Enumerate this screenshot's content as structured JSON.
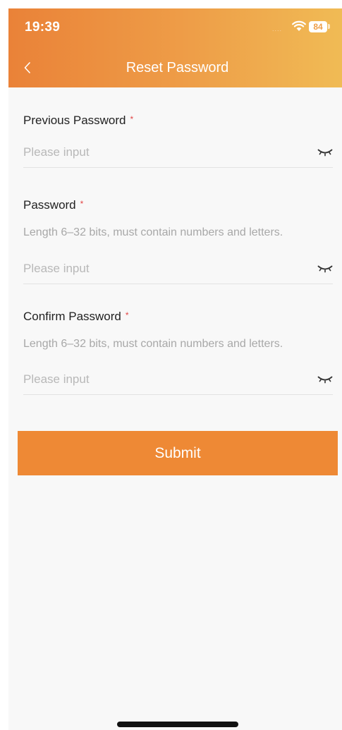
{
  "status_bar": {
    "time": "19:39",
    "signal": "....",
    "battery": "84"
  },
  "nav": {
    "title": "Reset Password",
    "back_icon": "chevron-left-icon"
  },
  "form": {
    "required_mark": "*",
    "fields": [
      {
        "label": "Previous Password",
        "hint": "",
        "placeholder": "Please input",
        "icon": "eye-closed-icon"
      },
      {
        "label": "Password",
        "hint": "Length 6–32 bits, must contain numbers and letters.",
        "placeholder": "Please input",
        "icon": "eye-closed-icon"
      },
      {
        "label": "Confirm Password",
        "hint": "Length 6–32 bits, must contain numbers and letters.",
        "placeholder": "Please input",
        "icon": "eye-closed-icon"
      }
    ]
  },
  "submit_label": "Submit",
  "colors": {
    "header_gradient_start": "#ea8238",
    "header_gradient_end": "#f0bb55",
    "accent": "#ee8935",
    "required": "#e24545",
    "background": "#f8f8f8"
  }
}
